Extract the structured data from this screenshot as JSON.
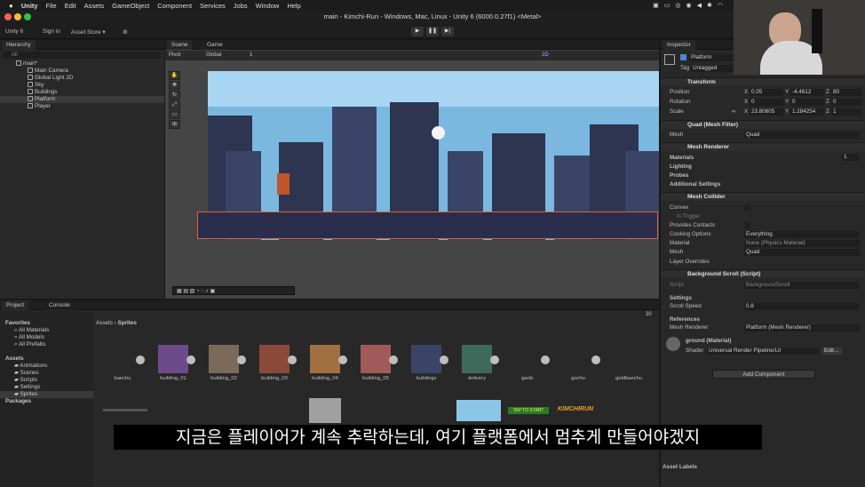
{
  "menubar": {
    "apple": "",
    "items": [
      "Unity",
      "File",
      "Edit",
      "Assets",
      "GameObject",
      "Component",
      "Services",
      "Jobs",
      "Window",
      "Help"
    ]
  },
  "window": {
    "title": "main - Kimchi-Run - Windows, Mac, Linux - Unity 6 (6000.0.27f1) <Metal>"
  },
  "toolbar": {
    "unity_label": "Unity 6",
    "sign_in": "Sign in",
    "asset_store": "Asset Store ▾"
  },
  "hierarchy": {
    "tab": "Hierarchy",
    "search_placeholder": "All",
    "scene": "main*",
    "items": [
      "Main Camera",
      "Global Light 2D",
      "Sky",
      "Buildings",
      "Platform",
      "Player"
    ]
  },
  "scene": {
    "tabs": [
      "Scene",
      "Game"
    ],
    "pivot": "Pivot",
    "global": "Global",
    "number": "1",
    "mode_2d": "2D"
  },
  "inspector": {
    "tab": "Inspector",
    "object_name": "Platform",
    "tag_label": "Tag",
    "tag_value": "Untagged",
    "transform": {
      "title": "Transform",
      "position_label": "Position",
      "position": [
        "0.05",
        "-4.4612",
        "80"
      ],
      "rotation_label": "Rotation",
      "rotation": [
        "0",
        "0",
        "0"
      ],
      "scale_label": "Scale",
      "scale": [
        "23.80605",
        "1.284254",
        "1"
      ]
    },
    "mesh_filter": {
      "title": "Quad (Mesh Filter)",
      "mesh_label": "Mesh",
      "mesh_value": "Quad"
    },
    "mesh_renderer": {
      "title": "Mesh Renderer",
      "materials": "Materials",
      "materials_count": "1",
      "lighting": "Lighting",
      "probes": "Probes",
      "additional": "Additional Settings"
    },
    "mesh_collider": {
      "title": "Mesh Collider",
      "convex": "Convex",
      "is_trigger": "Is Trigger",
      "contacts": "Provides Contacts",
      "cooking_label": "Cooking Options",
      "cooking_value": "Everything",
      "material_label": "Material",
      "material_value": "None (Physics Material)",
      "mesh_label": "Mesh",
      "mesh_value": "Quad",
      "overrides": "Layer Overrides"
    },
    "bg_scroll": {
      "title": "Background Scroll (Script)",
      "script_label": "Script",
      "script_value": "BackgroundScroll",
      "settings": "Settings",
      "speed_label": "Scroll Speed",
      "speed_value": "0.8",
      "references": "References",
      "renderer_label": "Mesh Renderer",
      "renderer_value": "Platform (Mesh Renderer)"
    },
    "material": {
      "title": "ground (Material)",
      "shader_label": "Shader",
      "shader_value": "Universal Render Pipeline/Lit",
      "edit": "Edit..."
    },
    "add_component": "Add Component",
    "asset_labels": "Asset Labels"
  },
  "project": {
    "tabs": [
      "Project",
      "Console"
    ],
    "breadcrumb_root": "Assets",
    "breadcrumb_current": "Sprites",
    "count": "30",
    "favorites": "Favorites",
    "fav_items": [
      "All Materials",
      "All Models",
      "All Prefabs"
    ],
    "assets": "Assets",
    "folders": [
      "Animations",
      "Scenes",
      "Scripts",
      "Settings",
      "Sprites"
    ],
    "packages": "Packages",
    "sprites": [
      "baechu",
      "building_01",
      "building_02",
      "building_03",
      "building_04",
      "building_05",
      "buildings",
      "delivery",
      "garlic",
      "gochu",
      "goldbaechu"
    ],
    "thumb_text_1": "TAP TO START",
    "thumb_text_2": "KIMCHIRUN"
  },
  "subtitle": "지금은 플레이어가 계속 추락하는데, 여기 플랫폼에서 멈추게 만들어야겠지",
  "colors": {
    "accent": "#e8622a",
    "sky": "#7ab8e0",
    "selection": "#3a3a3a"
  }
}
